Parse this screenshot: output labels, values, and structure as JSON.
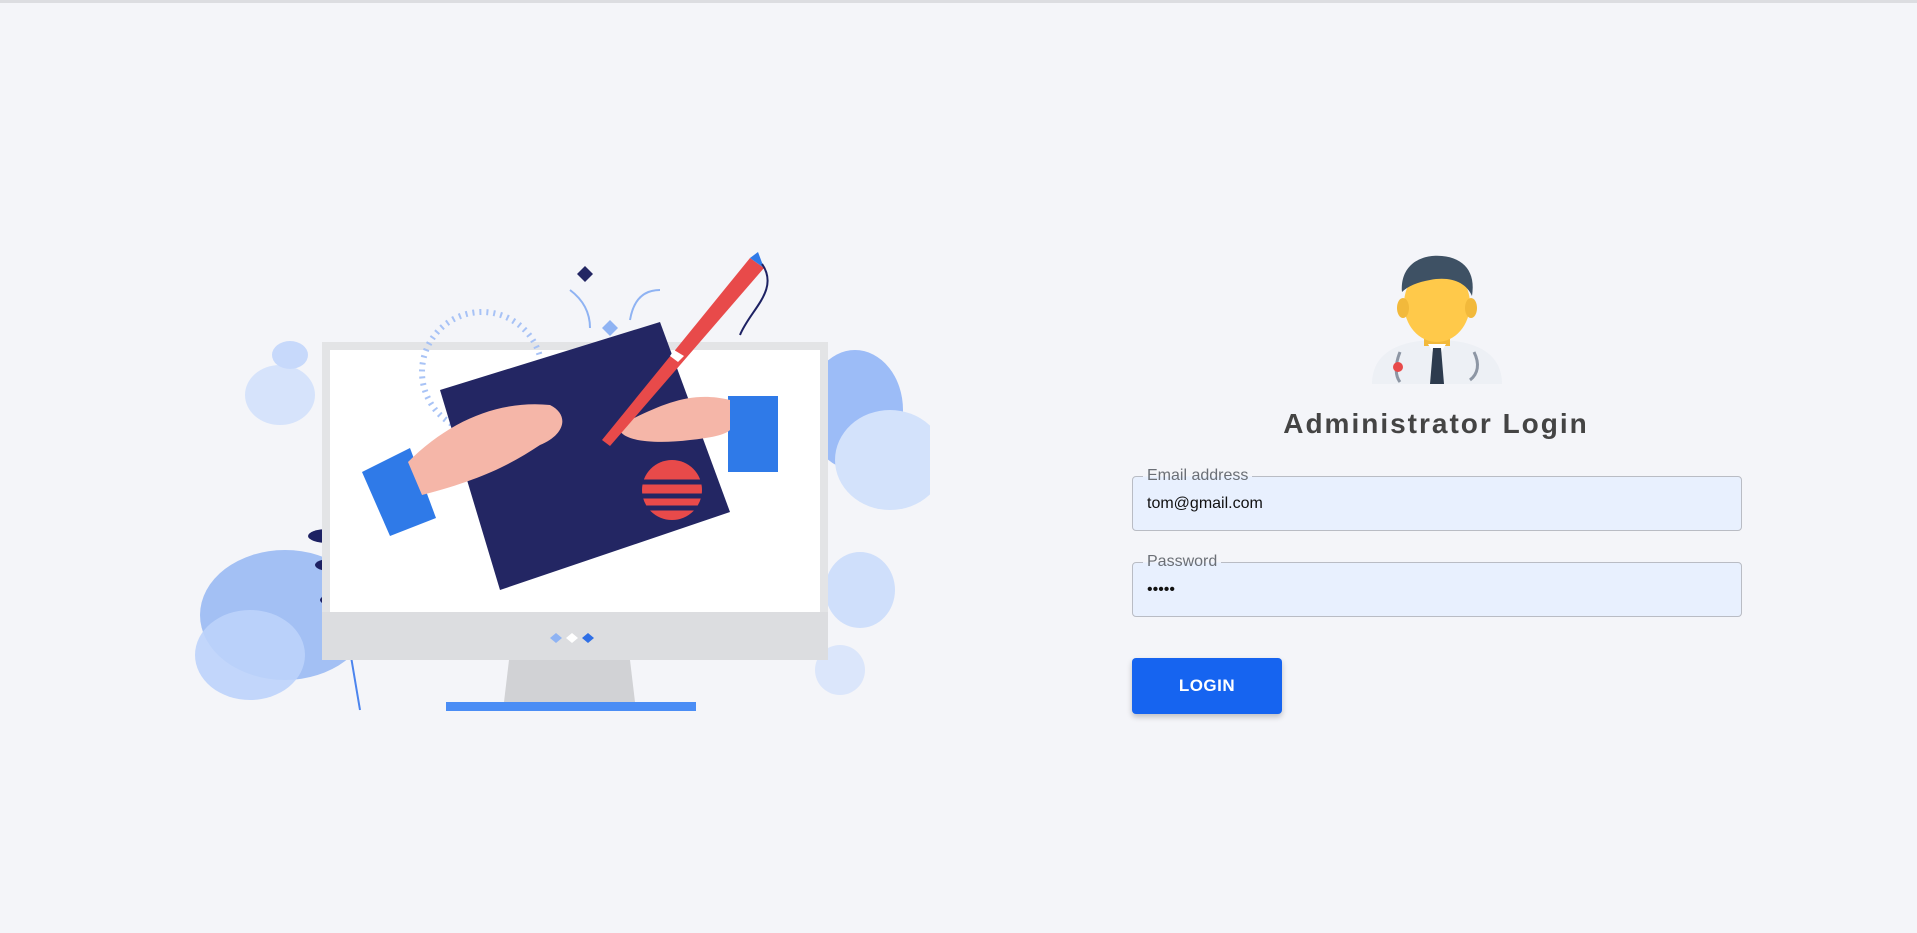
{
  "login": {
    "title": "Administrator Login",
    "email": {
      "label": "Email address",
      "value": "tom@gmail.com"
    },
    "password": {
      "label": "Password",
      "value": "•••••"
    },
    "submit_label": "LOGIN"
  },
  "colors": {
    "background": "#f4f5f9",
    "accent": "#1664f0",
    "input_fill": "#e8f0fe"
  },
  "icons": {
    "illustration": "monitor-hands-illustration",
    "avatar": "doctor-avatar-icon"
  }
}
